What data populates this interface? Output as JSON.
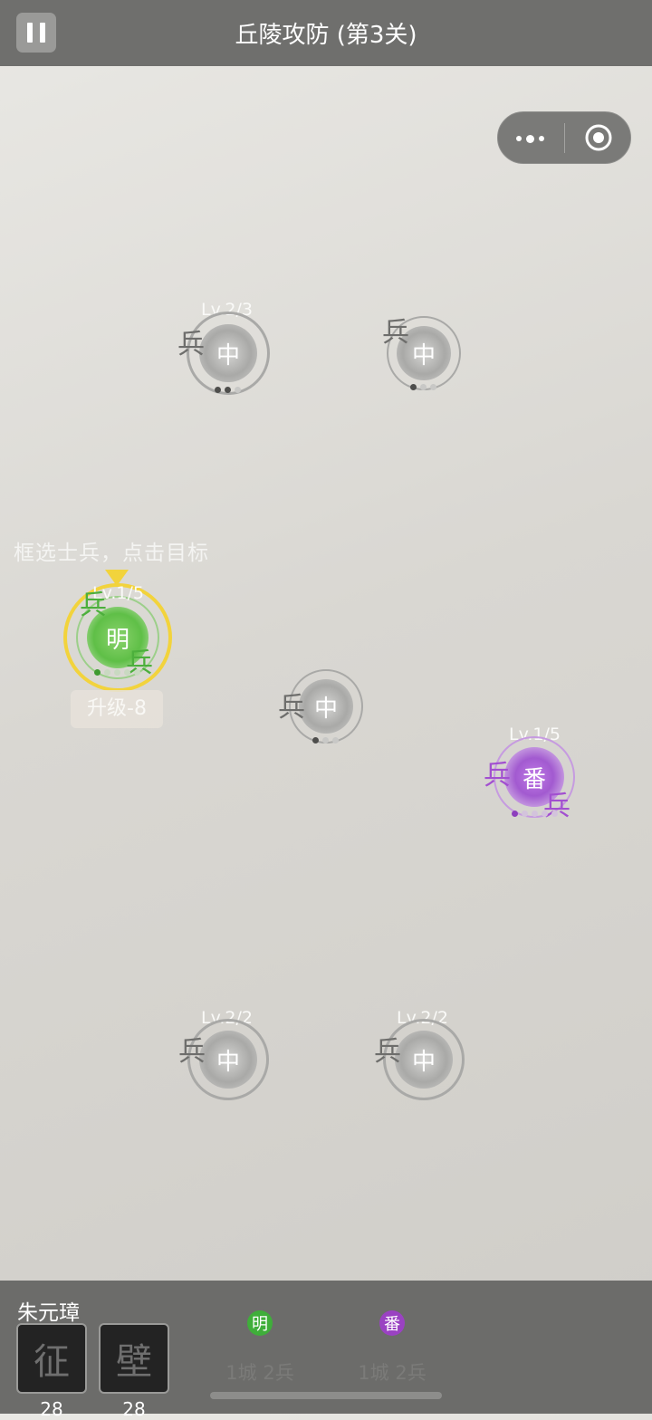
{
  "header": {
    "title": "丘陵攻防 (第3关)",
    "pause_icon": "pause-icon",
    "more_icon": "more-dots-icon",
    "close_icon": "target-circle-icon"
  },
  "hint": "框选士兵，点击目标",
  "soldier_char": "兵",
  "cities": [
    {
      "id": "neutral-top-left",
      "char": "中",
      "level": "Lv.2/3",
      "faction": "neutral"
    },
    {
      "id": "neutral-top-right",
      "char": "中",
      "level": "",
      "faction": "neutral"
    },
    {
      "id": "player-ming",
      "char": "明",
      "level": "Lv.1/5",
      "faction": "ming",
      "upgrade": "升级-8"
    },
    {
      "id": "neutral-center",
      "char": "中",
      "level": "",
      "faction": "neutral"
    },
    {
      "id": "enemy-fan",
      "char": "番",
      "level": "Lv.1/5",
      "faction": "fan"
    },
    {
      "id": "neutral-bottom-left",
      "char": "中",
      "level": "Lv.2/2",
      "faction": "neutral"
    },
    {
      "id": "neutral-bottom-right",
      "char": "中",
      "level": "Lv.2/2",
      "faction": "neutral"
    }
  ],
  "bottom": {
    "player_name": "朱元璋",
    "skills": [
      {
        "char": "征",
        "count": "28"
      },
      {
        "char": "壁",
        "count": "28"
      }
    ],
    "factions": [
      {
        "char": "明",
        "info": "1城 2兵",
        "color": "#3fae3a"
      },
      {
        "char": "番",
        "info": "1城 2兵",
        "color": "#9a42c2"
      }
    ]
  },
  "colors": {
    "ming": "#4caf3c",
    "fan": "#a24fd0",
    "neutral": "#8a8a88",
    "selection": "#f2d33c"
  }
}
